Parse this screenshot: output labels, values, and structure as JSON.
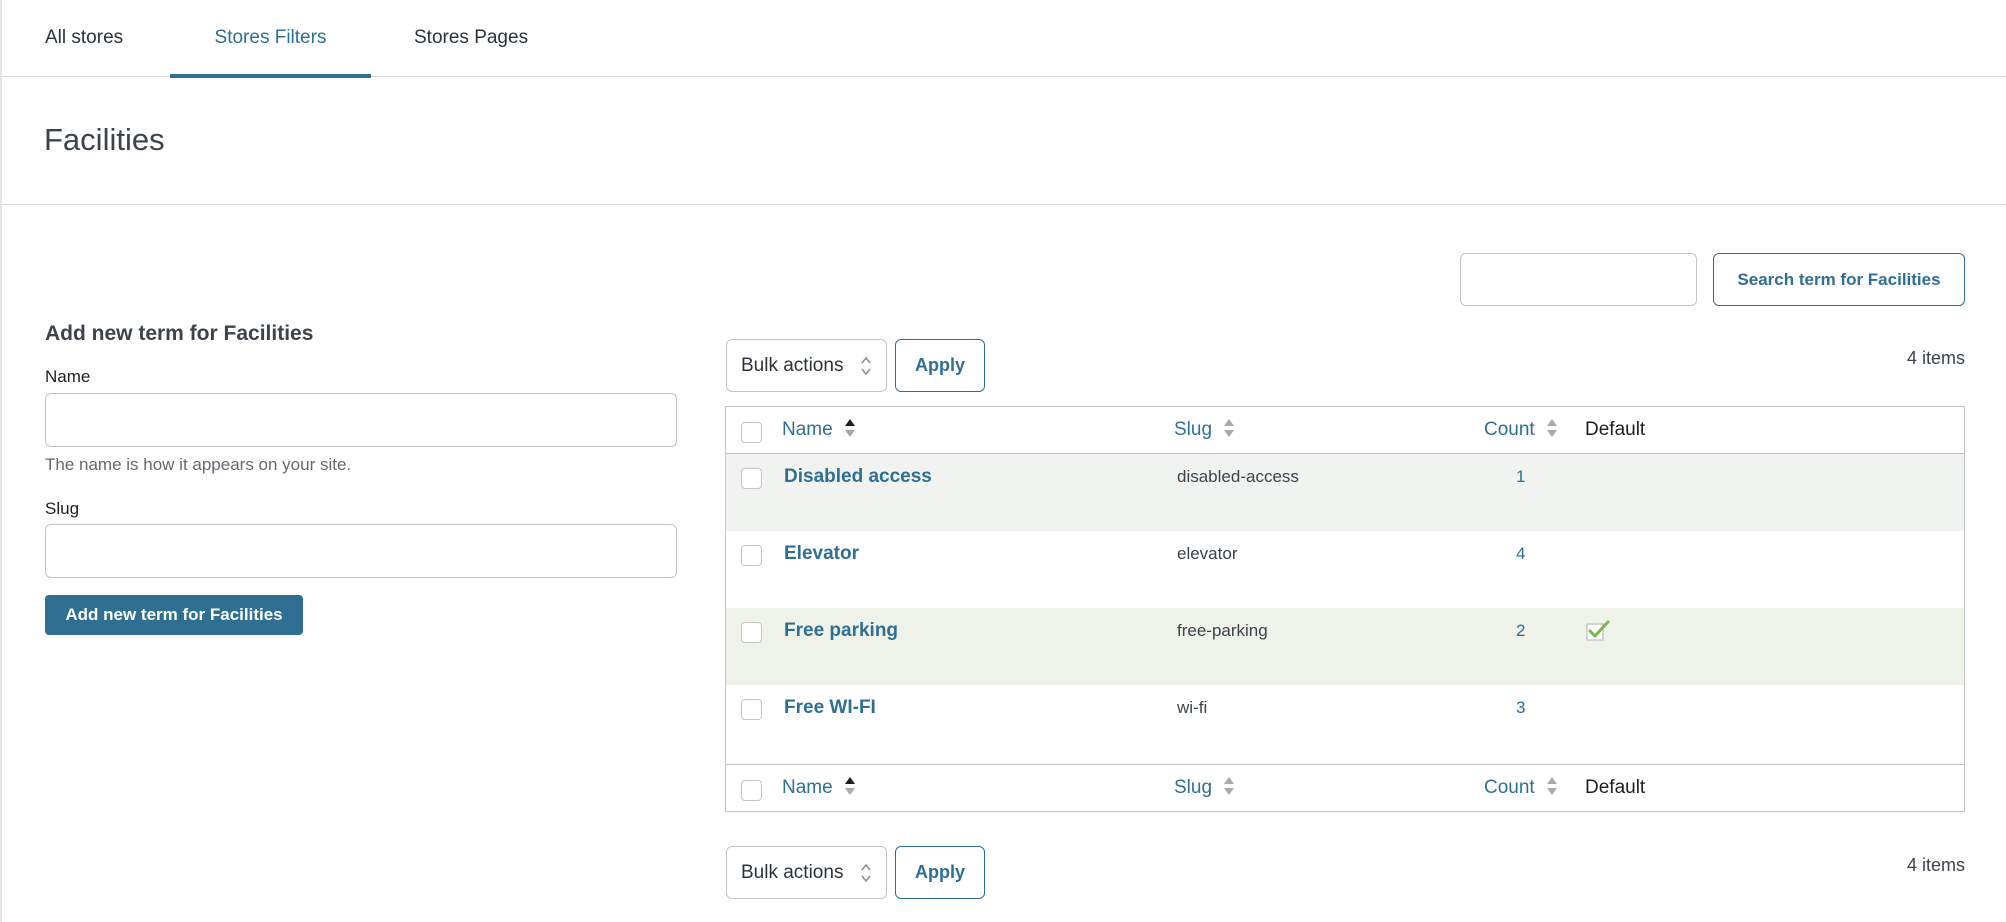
{
  "tabs": [
    {
      "label": "All stores"
    },
    {
      "label": "Stores Filters",
      "active": true
    },
    {
      "label": "Stores Pages"
    }
  ],
  "page": {
    "title": "Facilities"
  },
  "search": {
    "placeholder": "",
    "button_label": "Search term for Facilities"
  },
  "form": {
    "heading": "Add new term for Facilities",
    "name_label": "Name",
    "name_help": "The name is how it appears on your site.",
    "slug_label": "Slug",
    "submit_label": "Add new term for Facilities"
  },
  "bulk": {
    "select_value": "Bulk actions",
    "apply_label": "Apply"
  },
  "items_count": "4 items",
  "table": {
    "columns": {
      "name": "Name",
      "slug": "Slug",
      "count": "Count",
      "default": "Default"
    },
    "rows": [
      {
        "name": "Disabled access",
        "slug": "disabled-access",
        "count": "1",
        "is_default": false,
        "bg": "#f1f3f1"
      },
      {
        "name": "Elevator",
        "slug": "elevator",
        "count": "4",
        "is_default": false,
        "bg": "#ffffff"
      },
      {
        "name": "Free parking",
        "slug": "free-parking",
        "count": "2",
        "is_default": true,
        "bg": "#eff2e9"
      },
      {
        "name": "Free WI-FI",
        "slug": "wi-fi",
        "count": "3",
        "is_default": false,
        "bg": "#ffffff"
      }
    ]
  },
  "colors": {
    "accent": "#2e6f92",
    "check": "#7ab648"
  }
}
